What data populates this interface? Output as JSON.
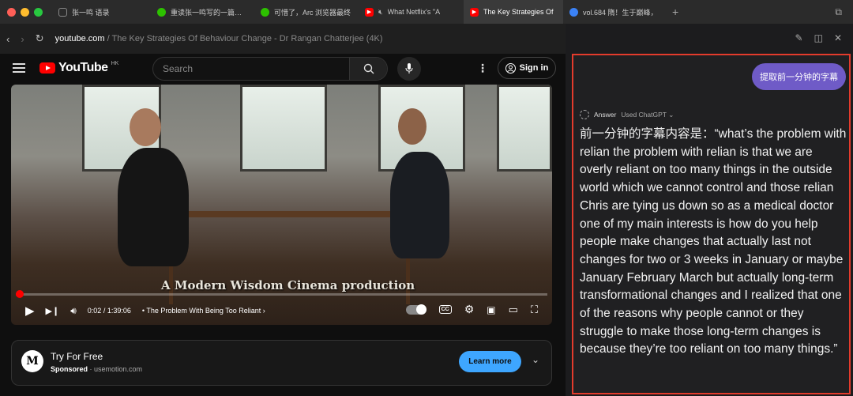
{
  "window": {
    "traffic_colors": [
      "#ff5f57",
      "#febc2e",
      "#28c840"
    ]
  },
  "tabs": [
    {
      "label": "张一鸣 语录",
      "icon": "message-icon",
      "color": "#888888",
      "active": false
    },
    {
      "label": "重读张一鸣写的一篇旧文",
      "icon": "wechat-icon",
      "color": "#2dc100",
      "active": false
    },
    {
      "label": "可惜了，Arc 浏览器最终",
      "icon": "wechat-icon",
      "color": "#2dc100",
      "active": false
    },
    {
      "label": "What Netflix's \"A",
      "icon": "youtube-icon",
      "color": "#ff0000",
      "active": false,
      "muted": true
    },
    {
      "label": "The Key Strategies Of",
      "icon": "youtube-icon",
      "color": "#ff0000",
      "active": true
    },
    {
      "label": "vol.684 隋！生于巅峰，",
      "icon": "compass-icon",
      "color": "#3b82f6",
      "active": false
    }
  ],
  "address_bar": {
    "host": "youtube.com",
    "path": " / The Key Strategies Of Behaviour Change - Dr Rangan Chatterjee (4K)"
  },
  "youtube": {
    "logo_text": "YouTube",
    "region": "HK",
    "search_placeholder": "Search",
    "sign_in": "Sign in"
  },
  "video": {
    "caption": "A Modern Wisdom Cinema production",
    "time": "0:02 / 1:39:06",
    "chapter": "The Problem With Being Too Reliant",
    "progress": 0.0004,
    "cc_label": "CC"
  },
  "ad": {
    "logo_letters": "M",
    "title": "Try For Free",
    "sponsored": "Sponsored",
    "domain": "usemotion.com",
    "cta": "Learn more"
  },
  "assistant": {
    "user_prompt": "提取前一分钟的字幕",
    "answer_label": "Answer",
    "model_label": "Used ChatGPT",
    "answer_text": "前一分钟的字幕内容是：“what’s the problem with relian the problem with relian is that we are overly reliant on too many things in the outside world which we cannot control and those relian Chris are tying us down so as a medical doctor one of my main interests is how do you help people make changes that actually last not changes for two or 3 weeks in January or maybe January February March but actually long-term transformational changes and I realized that one of the reasons why people cannot or they struggle to make those long-term changes is because they’re too reliant on too many things.”"
  }
}
